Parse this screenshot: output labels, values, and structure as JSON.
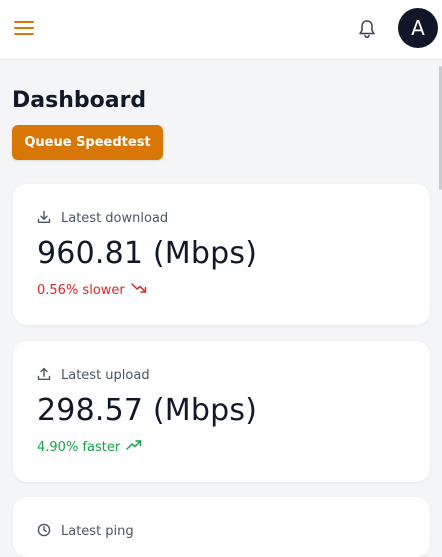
{
  "topbar": {
    "menu_icon": "hamburger-menu-icon",
    "notifications_icon": "bell-icon",
    "avatar_initial": "A",
    "accent_color": "#d97706",
    "avatar_color": "#0f1729"
  },
  "page": {
    "title": "Dashboard",
    "queue_button_label": "Queue Speedtest"
  },
  "cards": {
    "download": {
      "icon": "download-icon",
      "label": "Latest download",
      "value": "960.81 (Mbps)",
      "change": "0.56% slower",
      "trend": "down",
      "trend_icon": "trending-down-icon",
      "trend_color": "#dc2626"
    },
    "upload": {
      "icon": "upload-icon",
      "label": "Latest upload",
      "value": "298.57 (Mbps)",
      "change": "4.90% faster",
      "trend": "up",
      "trend_icon": "trending-up-icon",
      "trend_color": "#16a34a"
    },
    "ping": {
      "icon": "clock-icon",
      "label": "Latest ping"
    }
  }
}
